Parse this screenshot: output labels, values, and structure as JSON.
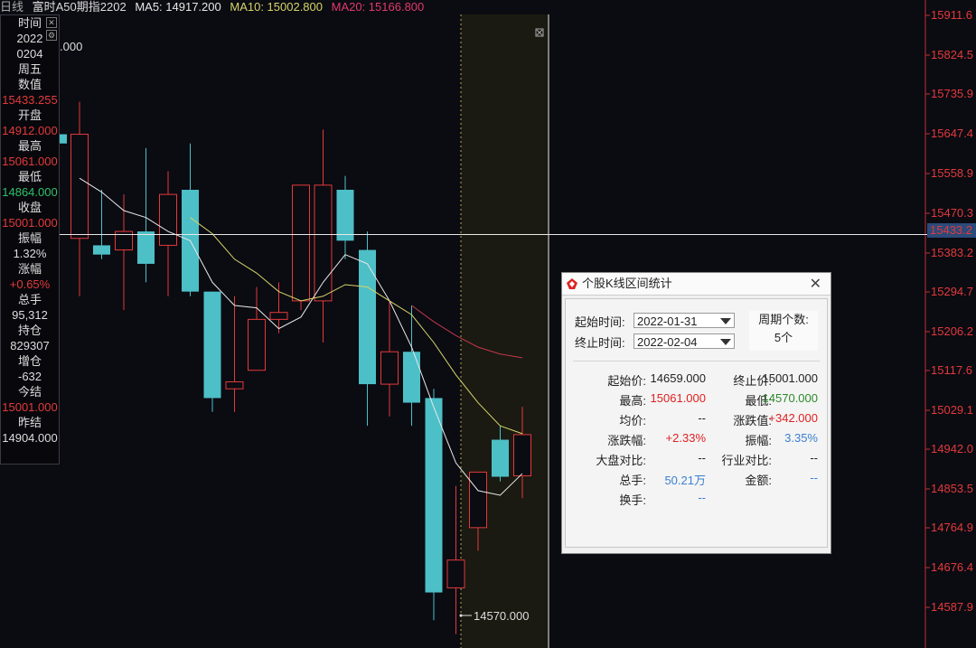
{
  "topbar": {
    "period": "日线",
    "instrument": "富时A50期指2202",
    "ma5": "MA5: 14917.200",
    "ma10": "MA10: 15002.800",
    "ma20": "MA20: 15166.800"
  },
  "colors": {
    "up": "#e23a3a",
    "down": "#4dbfc7",
    "ma5": "#e8e8e8",
    "ma10": "#d6d56a",
    "ma20": "#c2384a",
    "green": "#2aa84a",
    "blue": "#3a7fd0"
  },
  "info_panel": {
    "rows": [
      "时间",
      "2022",
      "0204",
      "周五",
      "数值",
      "15433.255",
      "开盘",
      "14912.000",
      "最高",
      "15061.000",
      "最低",
      "14864.000",
      "收盘",
      "15001.000",
      "振幅",
      "1.32%",
      "涨幅",
      "+0.65%",
      "总手",
      "95,312",
      "持仓",
      "829307",
      "增仓",
      "-632",
      "今结",
      "15001.000",
      "昨结",
      "14904.000"
    ],
    "close_icon": "close-icon",
    "settings_icon": "gear-icon"
  },
  "fragment_text": ".000",
  "y_axis_labels": [
    "15911.6",
    "15824.5",
    "15735.9",
    "15647.4",
    "15558.9",
    "15470.3",
    "15383.2",
    "15294.7",
    "15206.2",
    "15117.6",
    "15029.1",
    "14942.0",
    "14853.5",
    "14764.9",
    "14676.4",
    "14587.9"
  ],
  "crosshair_price": "15433.2",
  "min_label": "14570.000",
  "chart_data": {
    "type": "candlestick",
    "ylim": [
      14540,
      15940
    ],
    "candles": [
      {
        "o": 15425,
        "h": 15720,
        "l": 15300,
        "c": 15650
      },
      {
        "o": 15410,
        "h": 15530,
        "l": 15380,
        "c": 15390
      },
      {
        "o": 15400,
        "h": 15520,
        "l": 15270,
        "c": 15440
      },
      {
        "o": 15440,
        "h": 15620,
        "l": 15330,
        "c": 15370
      },
      {
        "o": 15410,
        "h": 15570,
        "l": 15300,
        "c": 15520
      },
      {
        "o": 15530,
        "h": 15630,
        "l": 15300,
        "c": 15310
      },
      {
        "o": 15310,
        "h": 15310,
        "l": 15050,
        "c": 15080
      },
      {
        "o": 15100,
        "h": 15300,
        "l": 15050,
        "c": 15115
      },
      {
        "o": 15140,
        "h": 15320,
        "l": 15140,
        "c": 15250
      },
      {
        "o": 15250,
        "h": 15330,
        "l": 15220,
        "c": 15265
      },
      {
        "o": 15290,
        "h": 15440,
        "l": 15270,
        "c": 15540
      },
      {
        "o": 15290,
        "h": 15660,
        "l": 15200,
        "c": 15540
      },
      {
        "o": 15530,
        "h": 15560,
        "l": 15380,
        "c": 15420
      },
      {
        "o": 15400,
        "h": 15440,
        "l": 15020,
        "c": 15110
      },
      {
        "o": 15110,
        "h": 15290,
        "l": 15040,
        "c": 15180
      },
      {
        "o": 15180,
        "h": 15280,
        "l": 15020,
        "c": 15070
      },
      {
        "o": 15080,
        "h": 15100,
        "l": 14600,
        "c": 14660
      },
      {
        "o": 14670,
        "h": 14890,
        "l": 14570,
        "c": 14730
      },
      {
        "o": 14800,
        "h": 14920,
        "l": 14750,
        "c": 14920
      },
      {
        "o": 14990,
        "h": 15020,
        "l": 14900,
        "c": 14910
      },
      {
        "o": 14912,
        "h": 15061,
        "l": 14864,
        "c": 15001
      }
    ],
    "ma5": [
      15555,
      15525,
      15485,
      15470,
      15440,
      15420,
      15330,
      15280,
      15275,
      15230,
      15255,
      15330,
      15390,
      15370,
      15290,
      15190,
      15060,
      14940,
      14880,
      14870,
      14917
    ],
    "ma10": [
      null,
      null,
      null,
      null,
      null,
      15470,
      15435,
      15380,
      15350,
      15310,
      15290,
      15300,
      15325,
      15320,
      15290,
      15260,
      15200,
      15130,
      15070,
      15020,
      15003
    ],
    "ma20": [
      null,
      null,
      null,
      null,
      null,
      null,
      null,
      null,
      null,
      null,
      null,
      null,
      null,
      null,
      null,
      15280,
      15245,
      15215,
      15190,
      15175,
      15167
    ]
  },
  "dialog": {
    "title": "个股K线区间统计",
    "start_label": "起始时间:",
    "start_value": "2022-01-31",
    "end_label": "终止时间:",
    "end_value": "2022-02-04",
    "period_label": "周期个数:",
    "period_value": "5个",
    "stats": [
      {
        "l1": "起始价:",
        "v1": "14659.000",
        "c1": "#222",
        "l2": "终止价:",
        "v2": "15001.000",
        "c2": "#222"
      },
      {
        "l1": "最高:",
        "v1": "15061.000",
        "c1": "#e02020",
        "l2": "最低:",
        "v2": "14570.000",
        "c2": "#2a8a2a"
      },
      {
        "l1": "均价:",
        "v1": "--",
        "c1": "#222",
        "l2": "涨跌值:",
        "v2": "+342.000",
        "c2": "#e02020"
      },
      {
        "l1": "涨跌幅:",
        "v1": "+2.33%",
        "c1": "#e02020",
        "l2": "振幅:",
        "v2": "3.35%",
        "c2": "#3a7fd0"
      },
      {
        "l1": "大盘对比:",
        "v1": "--",
        "c1": "#222",
        "l2": "行业对比:",
        "v2": "--",
        "c2": "#222"
      },
      {
        "l1": "总手:",
        "v1": "50.21万",
        "c1": "#3a7fd0",
        "l2": "金额:",
        "v2": "--",
        "c2": "#3a7fd0"
      },
      {
        "l1": "换手:",
        "v1": "--",
        "c1": "#3a7fd0",
        "l2": "",
        "v2": "",
        "c2": "#222"
      }
    ]
  }
}
